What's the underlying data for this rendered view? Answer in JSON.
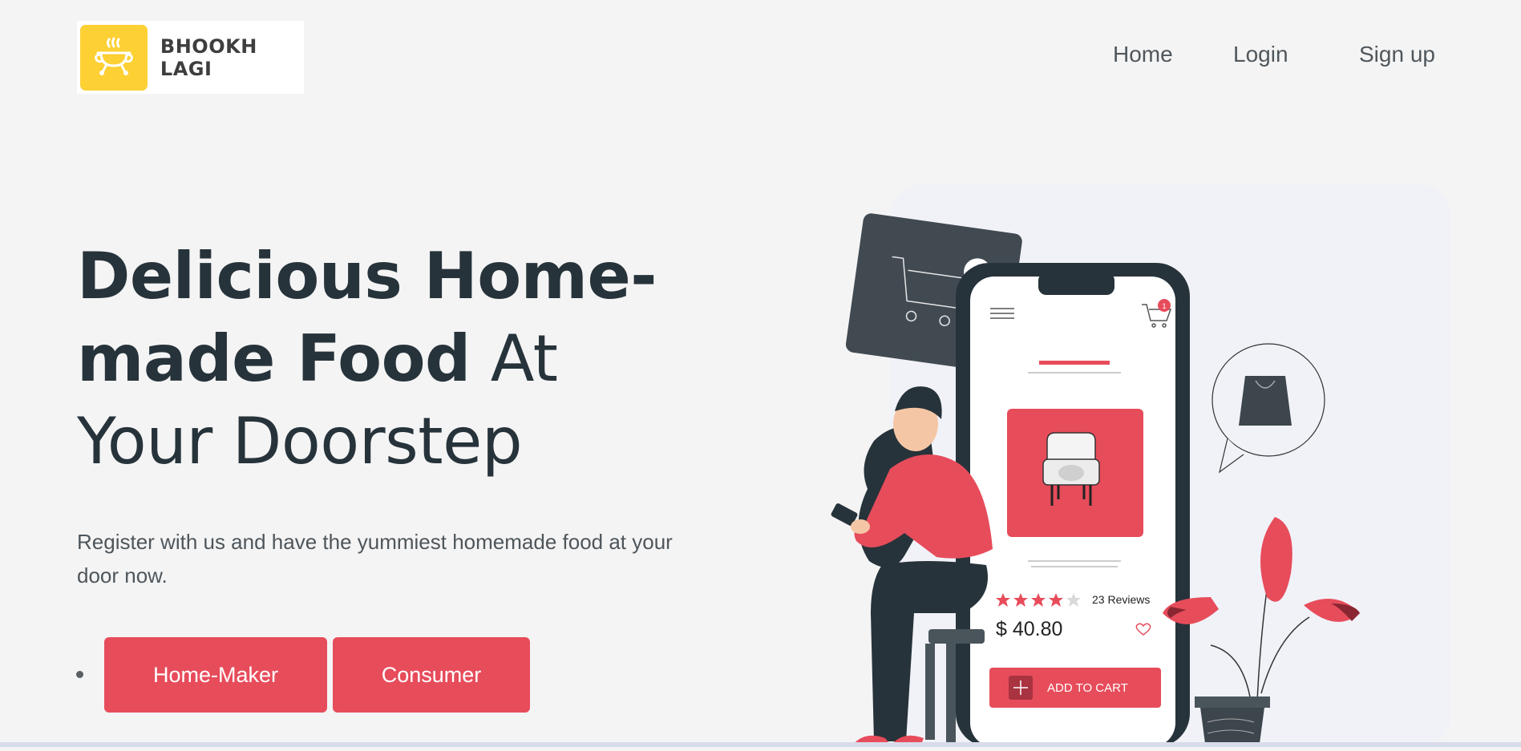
{
  "brand": {
    "name": "BHOOKH LAGI",
    "logo_bg": "#fdd034",
    "icon": "food-pot-icon"
  },
  "nav": {
    "home": "Home",
    "login": "Login",
    "signup": "Sign up"
  },
  "hero": {
    "title_bold": "Delicious Home-made Food",
    "title_light": " At Your Doorstep",
    "subtitle": "Register with us and have the yummiest homemade food at your door now.",
    "buttons": {
      "homemaker": "Home-Maker",
      "consumer": "Consumer"
    }
  },
  "illustration": {
    "cart_badge": "1",
    "reviews": "23 Reviews",
    "rating": 4,
    "rating_max": 5,
    "price": "$ 40.80",
    "add_to_cart": "ADD TO CART"
  },
  "colors": {
    "accent": "#e74c5b",
    "dark": "#27333a",
    "background": "#f4f4f5"
  }
}
